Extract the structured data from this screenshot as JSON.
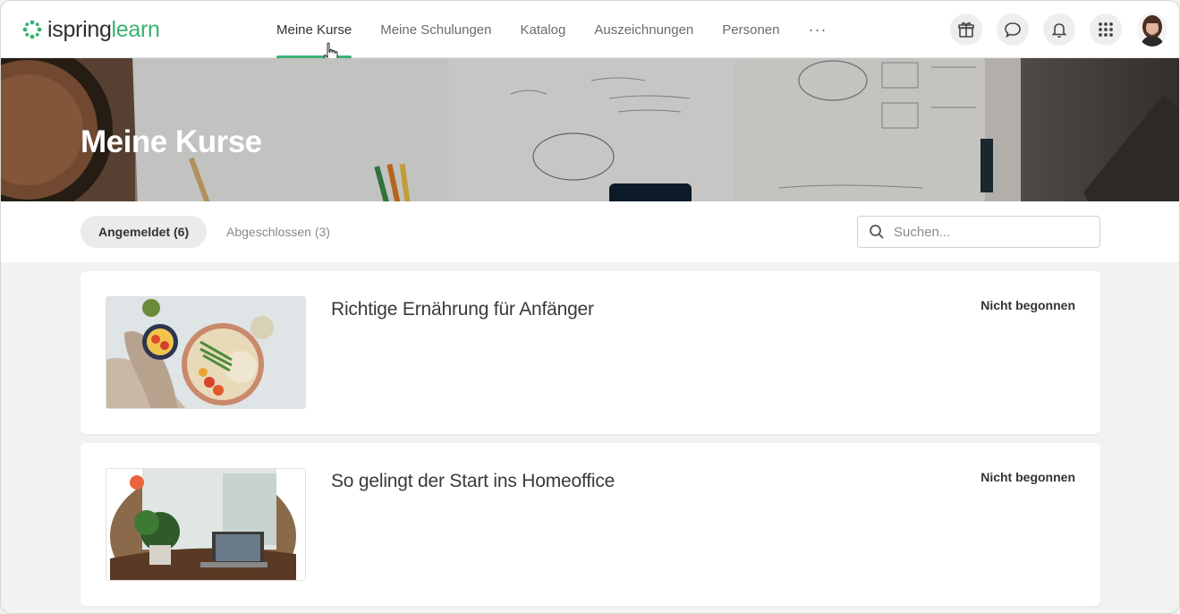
{
  "app": {
    "logo_part1": "ispring",
    "logo_part2": "learn",
    "brand_color": "#3bb273"
  },
  "nav": {
    "items": [
      {
        "label": "Meine Kurse",
        "active": true
      },
      {
        "label": "Meine Schulungen",
        "active": false
      },
      {
        "label": "Katalog",
        "active": false
      },
      {
        "label": "Auszeichnungen",
        "active": false
      },
      {
        "label": "Personen",
        "active": false
      }
    ],
    "more_label": "···"
  },
  "header_icons": [
    "gift-icon",
    "chat-icon",
    "bell-icon",
    "apps-grid-icon"
  ],
  "banner": {
    "title": "Meine Kurse"
  },
  "tabs": {
    "enrolled": "Angemeldet (6)",
    "completed": "Abgeschlossen (3)"
  },
  "search": {
    "placeholder": "Suchen..."
  },
  "courses": [
    {
      "title": "Richtige Ernährung für Anfänger",
      "status": "Nicht begonnen"
    },
    {
      "title": "So gelingt der Start ins Homeoffice",
      "status": "Nicht begonnen"
    }
  ]
}
